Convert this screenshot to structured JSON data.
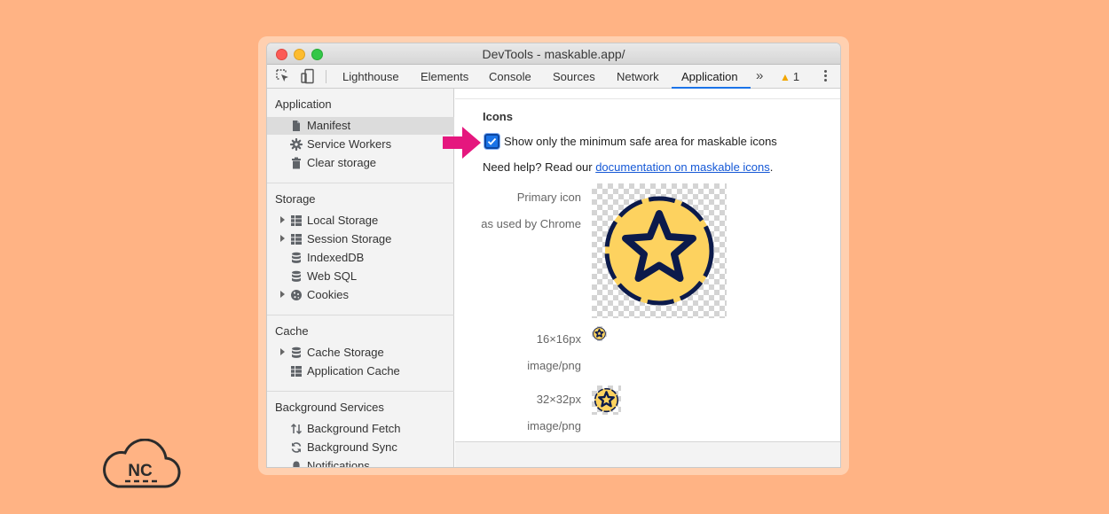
{
  "window": {
    "title": "DevTools - maskable.app/"
  },
  "toolbar": {
    "icons": [
      "inspect-element-icon",
      "device-toolbar-icon"
    ],
    "tabs": [
      {
        "label": "Lighthouse"
      },
      {
        "label": "Elements"
      },
      {
        "label": "Console"
      },
      {
        "label": "Sources"
      },
      {
        "label": "Network"
      },
      {
        "label": "Application",
        "active": true
      }
    ],
    "more_label": "»",
    "warning_count": "1",
    "accent_color": "#1a73e8"
  },
  "sidebar": {
    "application": {
      "title": "Application",
      "items": [
        {
          "label": "Manifest",
          "icon": "file-icon",
          "selected": true
        },
        {
          "label": "Service Workers",
          "icon": "gear-icon"
        },
        {
          "label": "Clear storage",
          "icon": "trash-icon"
        }
      ]
    },
    "storage": {
      "title": "Storage",
      "items": [
        {
          "label": "Local Storage",
          "icon": "grid-icon",
          "expandable": true
        },
        {
          "label": "Session Storage",
          "icon": "grid-icon",
          "expandable": true
        },
        {
          "label": "IndexedDB",
          "icon": "database-icon"
        },
        {
          "label": "Web SQL",
          "icon": "database-icon"
        },
        {
          "label": "Cookies",
          "icon": "cookie-icon",
          "expandable": true
        }
      ]
    },
    "cache": {
      "title": "Cache",
      "items": [
        {
          "label": "Cache Storage",
          "icon": "database-icon",
          "expandable": true
        },
        {
          "label": "Application Cache",
          "icon": "grid-icon"
        }
      ]
    },
    "background": {
      "title": "Background Services",
      "items": [
        {
          "label": "Background Fetch",
          "icon": "updown-arrows-icon"
        },
        {
          "label": "Background Sync",
          "icon": "sync-icon"
        },
        {
          "label": "Notifications",
          "icon": "bell-icon"
        }
      ]
    }
  },
  "main": {
    "icons_heading": "Icons",
    "checkbox": {
      "label": "Show only the minimum safe area for maskable icons",
      "checked": true
    },
    "help": {
      "prefix": "Need help? Read our ",
      "link": "documentation on maskable icons",
      "suffix": "."
    },
    "primary_icon": {
      "label": "Primary icon",
      "sublabel": "as used by Chrome"
    },
    "icon_16": {
      "size": "16×16px",
      "type": "image/png"
    },
    "icon_32": {
      "size": "32×32px",
      "type": "image/png"
    },
    "icon_colors": {
      "fill": "#fdd25f",
      "stroke": "#0b1a4b"
    },
    "annotation_arrow_color": "#e5177e"
  },
  "logo": {
    "text": "NC"
  }
}
